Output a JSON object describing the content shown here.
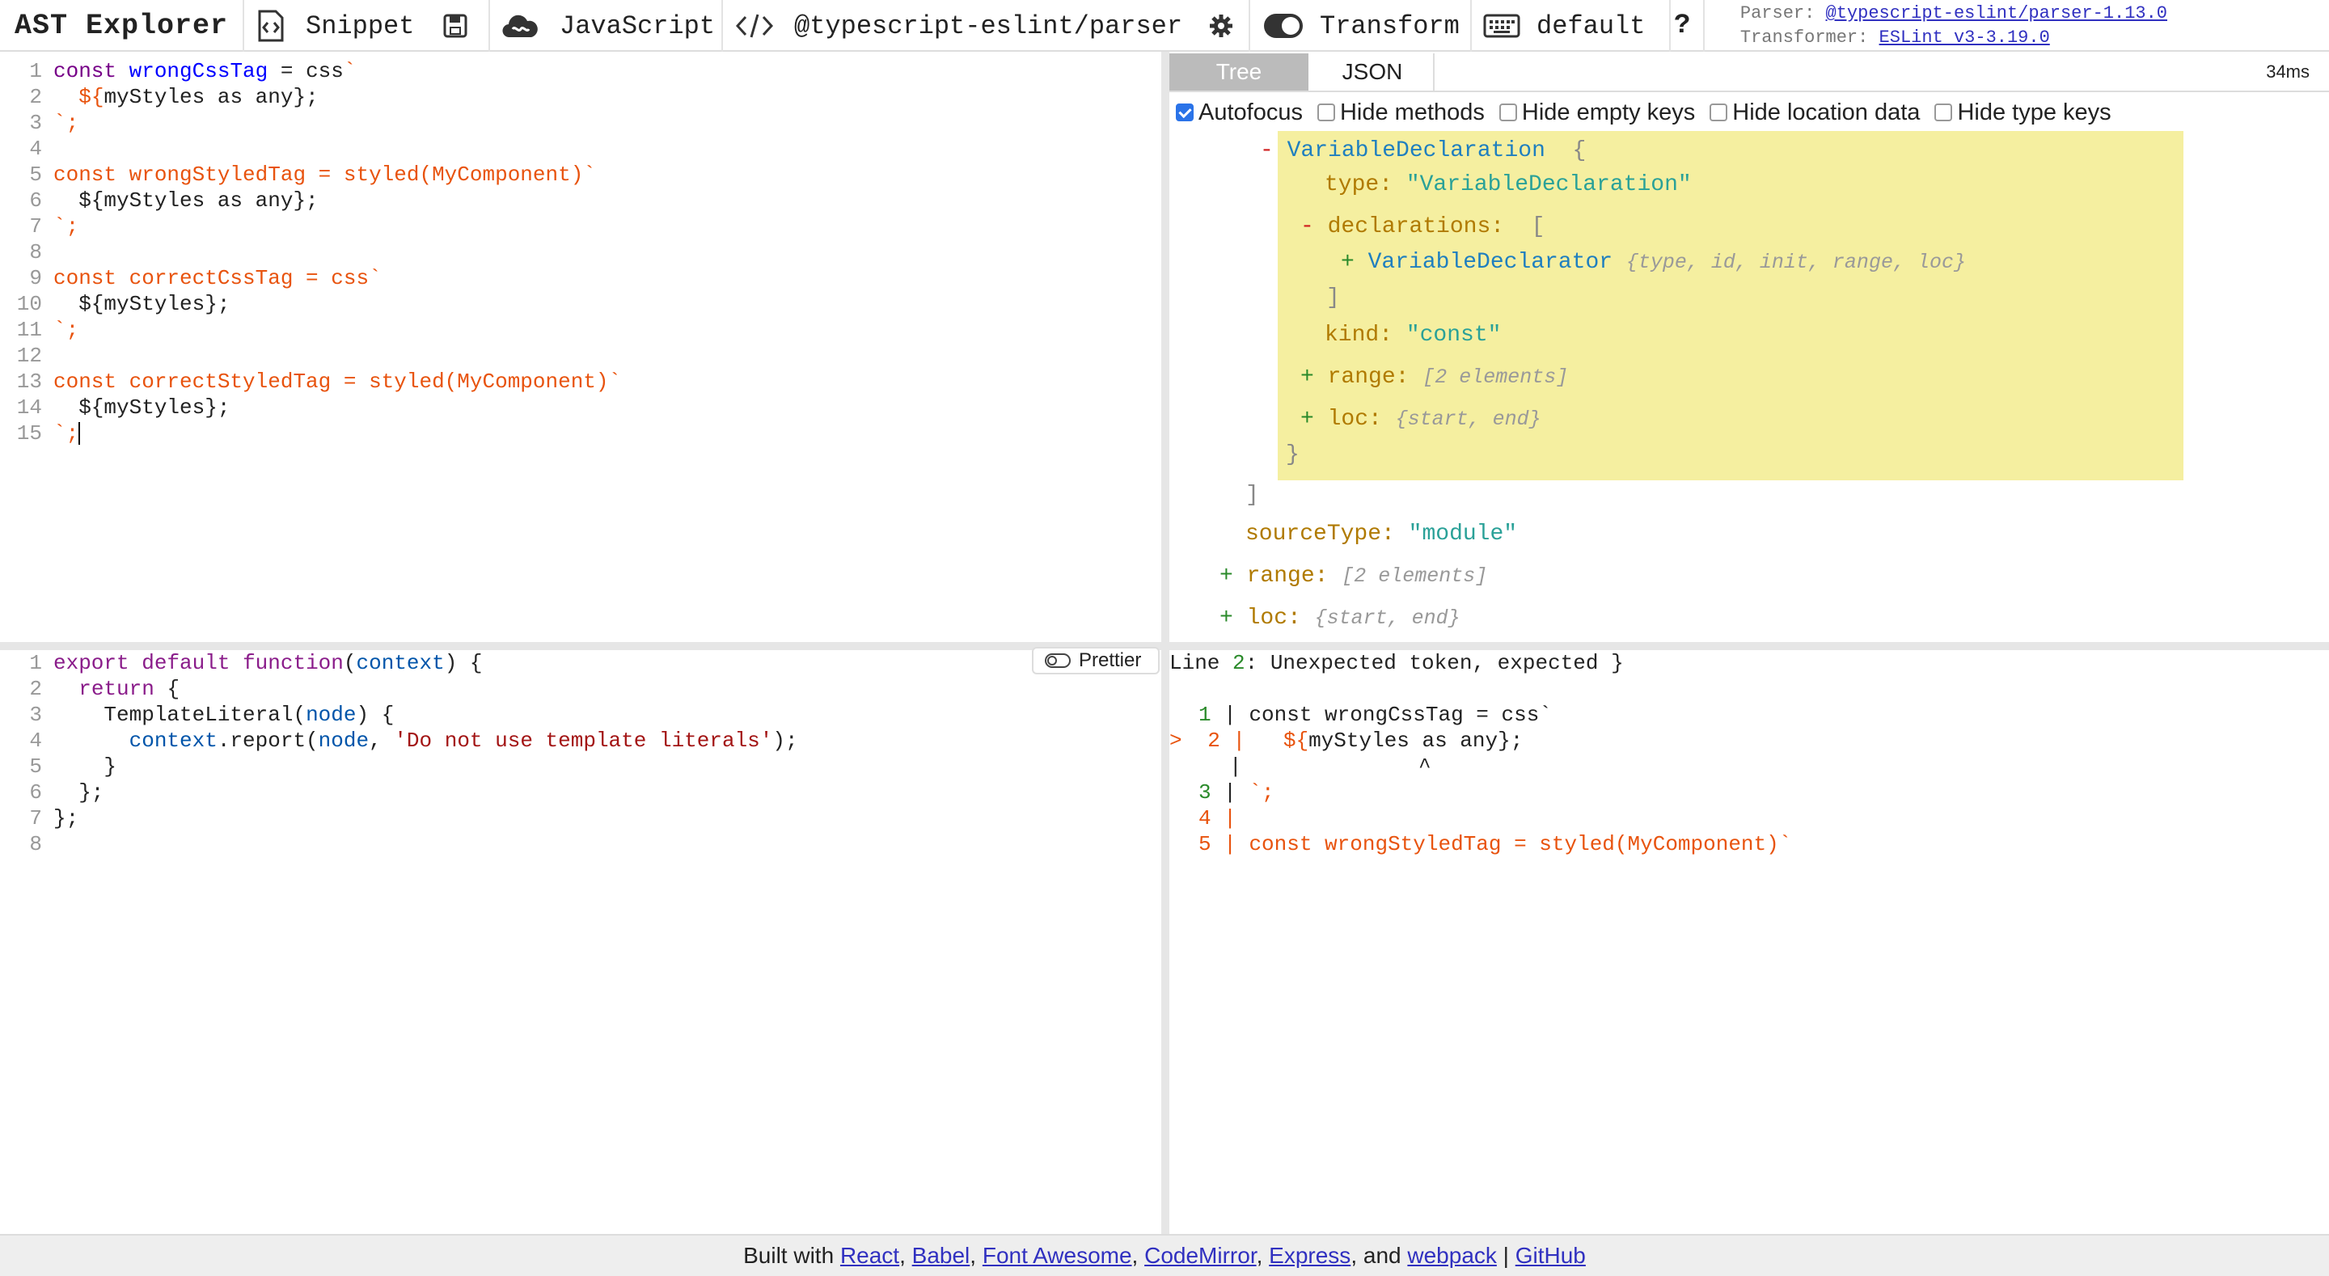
{
  "toolbar": {
    "title": "AST Explorer",
    "snippet_label": "Snippet",
    "language_label": "JavaScript",
    "parser_label": "@typescript-eslint/parser",
    "transform_label": "Transform",
    "keymap_label": "default",
    "help_label": "?",
    "parser_meta_label": "Parser:",
    "parser_meta_link": "@typescript-eslint/parser-1.13.0",
    "transformer_meta_label": "Transformer:",
    "transformer_meta_link": "ESLint v3-3.19.0"
  },
  "source_editor": {
    "lines": [
      {
        "n": "1"
      },
      {
        "n": "2"
      },
      {
        "n": "3"
      },
      {
        "n": "4"
      },
      {
        "n": "5"
      },
      {
        "n": "6"
      },
      {
        "n": "7"
      },
      {
        "n": "8"
      },
      {
        "n": "9"
      },
      {
        "n": "10"
      },
      {
        "n": "11"
      },
      {
        "n": "12"
      },
      {
        "n": "13"
      },
      {
        "n": "14"
      },
      {
        "n": "15"
      }
    ],
    "l1": {
      "a": "const ",
      "b": "wrongCssTag",
      "c": " = css",
      "d": "`"
    },
    "l2": {
      "a": "  ",
      "b": "${",
      "c": "myStyles as any};"
    },
    "l3": {
      "a": "`;"
    },
    "l5": {
      "a": "const wrongStyledTag = styled(MyComponent)`"
    },
    "l6": {
      "a": "  ${myStyles as any};"
    },
    "l7": {
      "a": "`;"
    },
    "l9": {
      "a": "const correctCssTag = css`"
    },
    "l10": {
      "a": "  ${myStyles};"
    },
    "l11": {
      "a": "`;"
    },
    "l13": {
      "a": "const correctStyledTag = styled(MyComponent)`"
    },
    "l14": {
      "a": "  ${myStyles};"
    },
    "l15": {
      "a": "`;"
    }
  },
  "tree": {
    "tab_tree": "Tree",
    "tab_json": "JSON",
    "timing": "34ms",
    "options": [
      "Autofocus",
      "Hide methods",
      "Hide empty keys",
      "Hide location data",
      "Hide type keys"
    ],
    "nodes": {
      "vd_toggle": "-",
      "vd_name": "VariableDeclaration",
      "vd_open": "{",
      "type_key": "type:",
      "type_val": "\"VariableDeclaration\"",
      "decl_toggle": "-",
      "decl_key": "declarations:",
      "decl_open": "[",
      "vdr_toggle": "+",
      "vdr_name": "VariableDeclarator",
      "vdr_meta": "{type, id, init, range, loc}",
      "decl_close": "]",
      "kind_key": "kind:",
      "kind_val": "\"const\"",
      "range_toggle": "+",
      "range_key": "range:",
      "range_meta": "[2 elements]",
      "loc_toggle": "+",
      "loc_key": "loc:",
      "loc_meta": "{start, end}",
      "vd_close": "}",
      "body_close": "]",
      "source_key": "sourceType:",
      "source_val": "\"module\"",
      "prog_range_toggle": "+",
      "prog_range_key": "range:",
      "prog_range_meta": "[2 elements]",
      "prog_loc_toggle": "+",
      "prog_loc_key": "loc:",
      "prog_loc_meta": "{start, end}"
    }
  },
  "transform_editor": {
    "prettier_label": "Prettier",
    "nums": [
      "1",
      "2",
      "3",
      "4",
      "5",
      "6",
      "7",
      "8"
    ],
    "l1": {
      "a": "export",
      "b": " ",
      "c": "default",
      "d": " ",
      "e": "function",
      "f": "(",
      "g": "context",
      "h": ") {"
    },
    "l2": {
      "a": "  ",
      "b": "return",
      "c": " {"
    },
    "l3": {
      "a": "    TemplateLiteral(",
      "b": "node",
      "c": ") {"
    },
    "l4": {
      "a": "      ",
      "b": "context",
      "c": ".report(",
      "d": "node",
      "e": ", ",
      "f": "'Do not use template literals'",
      "g": ");"
    },
    "l5": {
      "a": "    }"
    },
    "l6": {
      "a": "  };"
    },
    "l7": {
      "a": "};"
    }
  },
  "output": {
    "error_prefix": "Line ",
    "error_line": "2",
    "error_msg": ": Unexpected token, expected }",
    "frame": {
      "r1_num": "1",
      "r1_bar": "|",
      "r1_code": "const wrongCssTag = css`",
      "r2_mark": ">",
      "r2_num": "2",
      "r2_bar": "|",
      "r2_dollar": "${",
      "r2_code": "myStyles as any};",
      "r2b_bar": "|",
      "r2b_caret": "^",
      "r3_num": "3",
      "r3_bar": "|",
      "r3_code": "`;",
      "r4_num": "4",
      "r4_bar": "|",
      "r5_num": "5",
      "r5_bar": "|",
      "r5_code": "const wrongStyledTag = styled(MyComponent)`"
    }
  },
  "footer": {
    "prefix": "Built with ",
    "react": "React",
    "babel": "Babel",
    "fa": "Font Awesome",
    "cm": "CodeMirror",
    "express": "Express",
    "and": ", and ",
    "webpack": "webpack",
    "pipe": " | ",
    "github": "GitHub",
    "comma": ", "
  },
  "colors": {
    "accent": "#2a73e8",
    "highlight": "#f5efa0",
    "string_orange": "#e8530e",
    "tree_name": "#1f7fbf"
  }
}
